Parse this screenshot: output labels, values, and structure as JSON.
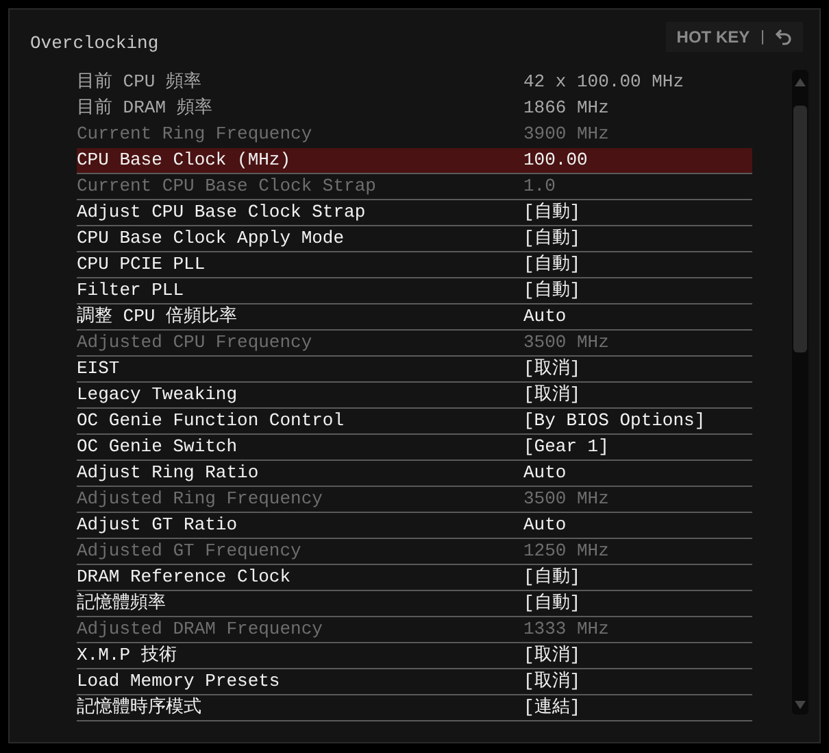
{
  "header": {
    "title": "Overclocking",
    "hotkey": "HOT KEY",
    "separator": "|"
  },
  "rows": [
    {
      "kind": "info",
      "label": "目前 CPU 頻率",
      "value": "42 x 100.00 MHz",
      "disabled": false,
      "selected": false
    },
    {
      "kind": "info",
      "label": "目前 DRAM 頻率",
      "value": "1866 MHz",
      "disabled": false,
      "selected": false
    },
    {
      "kind": "info",
      "label": "Current Ring Frequency",
      "value": "3900 MHz",
      "disabled": true,
      "selected": false
    },
    {
      "kind": "setting",
      "label": "CPU Base Clock (MHz)",
      "value": "100.00",
      "disabled": false,
      "selected": true
    },
    {
      "kind": "setting",
      "label": "Current CPU Base Clock Strap",
      "value": "1.0",
      "disabled": true,
      "selected": false
    },
    {
      "kind": "setting",
      "label": "Adjust CPU Base Clock Strap",
      "value": "[自動]",
      "disabled": false,
      "selected": false
    },
    {
      "kind": "setting",
      "label": "CPU Base Clock Apply Mode",
      "value": "[自動]",
      "disabled": false,
      "selected": false
    },
    {
      "kind": "setting",
      "label": "CPU PCIE PLL",
      "value": "[自動]",
      "disabled": false,
      "selected": false
    },
    {
      "kind": "setting",
      "label": "Filter PLL",
      "value": "[自動]",
      "disabled": false,
      "selected": false
    },
    {
      "kind": "setting",
      "label": "調整 CPU 倍頻比率",
      "value": "Auto",
      "disabled": false,
      "selected": false
    },
    {
      "kind": "setting",
      "label": "Adjusted CPU Frequency",
      "value": "3500 MHz",
      "disabled": true,
      "selected": false
    },
    {
      "kind": "setting",
      "label": "EIST",
      "value": "[取消]",
      "disabled": false,
      "selected": false
    },
    {
      "kind": "setting",
      "label": "Legacy Tweaking",
      "value": "[取消]",
      "disabled": false,
      "selected": false
    },
    {
      "kind": "setting",
      "label": "OC Genie Function Control",
      "value": "[By BIOS Options]",
      "disabled": false,
      "selected": false
    },
    {
      "kind": "setting",
      "label": "OC Genie Switch",
      "value": "[Gear 1]",
      "disabled": false,
      "selected": false
    },
    {
      "kind": "setting",
      "label": "Adjust Ring Ratio",
      "value": "Auto",
      "disabled": false,
      "selected": false
    },
    {
      "kind": "setting",
      "label": "Adjusted Ring Frequency",
      "value": "3500 MHz",
      "disabled": true,
      "selected": false
    },
    {
      "kind": "setting",
      "label": "Adjust GT Ratio",
      "value": "Auto",
      "disabled": false,
      "selected": false
    },
    {
      "kind": "setting",
      "label": "Adjusted GT Frequency",
      "value": "1250 MHz",
      "disabled": true,
      "selected": false
    },
    {
      "kind": "setting",
      "label": "DRAM Reference Clock",
      "value": "[自動]",
      "disabled": false,
      "selected": false
    },
    {
      "kind": "setting",
      "label": "記憶體頻率",
      "value": "[自動]",
      "disabled": false,
      "selected": false
    },
    {
      "kind": "setting",
      "label": "Adjusted DRAM Frequency",
      "value": "1333 MHz",
      "disabled": true,
      "selected": false
    },
    {
      "kind": "setting",
      "label": "X.M.P 技術",
      "value": "[取消]",
      "disabled": false,
      "selected": false
    },
    {
      "kind": "setting",
      "label": "Load Memory Presets",
      "value": "[取消]",
      "disabled": false,
      "selected": false
    },
    {
      "kind": "setting",
      "label": "記憶體時序模式",
      "value": "[連結]",
      "disabled": false,
      "selected": false
    }
  ]
}
